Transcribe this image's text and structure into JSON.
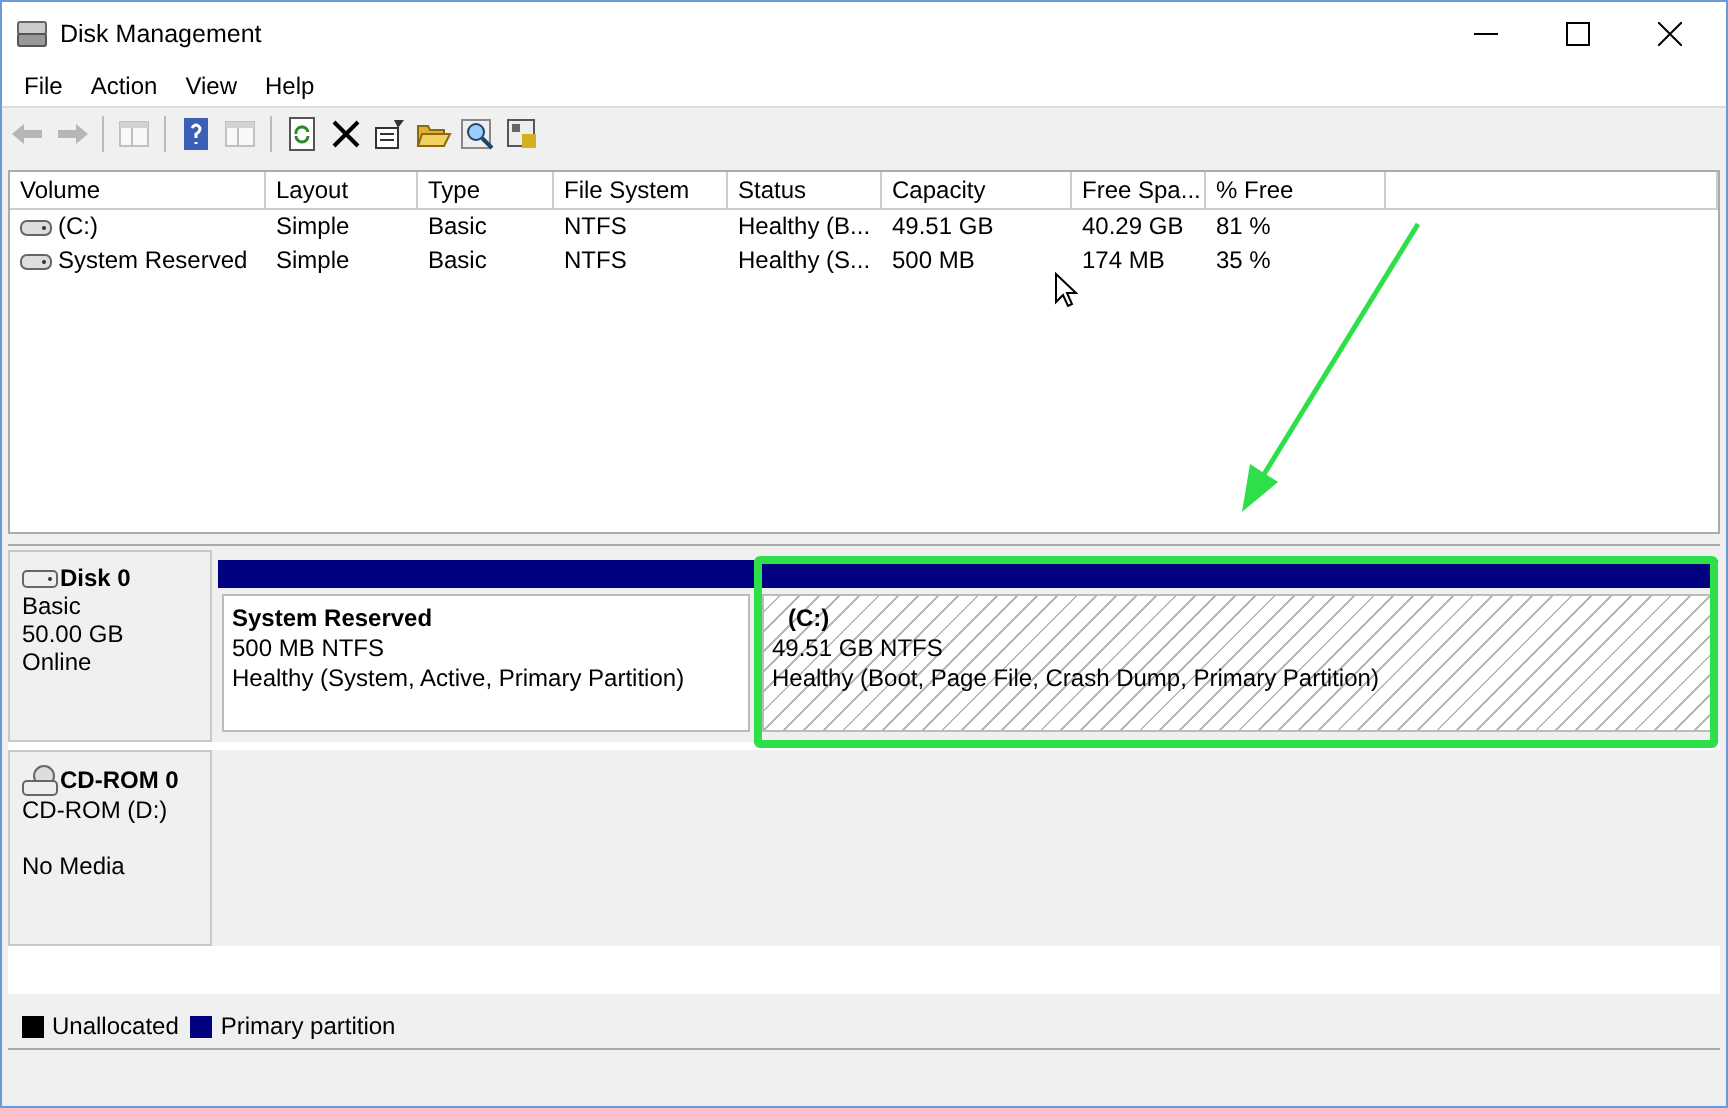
{
  "window": {
    "title": "Disk Management"
  },
  "menu": [
    "File",
    "Action",
    "View",
    "Help"
  ],
  "toolbar": [
    {
      "kind": "back",
      "disabled": true
    },
    {
      "kind": "forward",
      "disabled": true
    },
    {
      "kind": "sep"
    },
    {
      "kind": "tree",
      "disabled": true
    },
    {
      "kind": "sep"
    },
    {
      "kind": "help",
      "disabled": false
    },
    {
      "kind": "pane",
      "disabled": true
    },
    {
      "kind": "sep"
    },
    {
      "kind": "refresh",
      "disabled": false
    },
    {
      "kind": "delete",
      "disabled": false
    },
    {
      "kind": "properties",
      "disabled": false
    },
    {
      "kind": "open",
      "disabled": false
    },
    {
      "kind": "explore",
      "disabled": false
    },
    {
      "kind": "settings",
      "disabled": false
    }
  ],
  "table": {
    "columns": [
      "Volume",
      "Layout",
      "Type",
      "File System",
      "Status",
      "Capacity",
      "Free Spa...",
      "% Free"
    ],
    "rows": [
      [
        "(C:)",
        "Simple",
        "Basic",
        "NTFS",
        "Healthy (B...",
        "49.51 GB",
        "40.29 GB",
        "81 %"
      ],
      [
        "System Reserved",
        "Simple",
        "Basic",
        "NTFS",
        "Healthy (S...",
        "500 MB",
        "174 MB",
        "35 %"
      ]
    ]
  },
  "disks": [
    {
      "kind": "disk",
      "name": "Disk 0",
      "lines": [
        "Basic",
        "50.00 GB",
        "Online"
      ],
      "partitions": [
        {
          "name": "System Reserved",
          "size": "500 MB NTFS",
          "status": "Healthy (System, Active, Primary Partition)",
          "selected": false
        },
        {
          "name": "(C:)",
          "size": "49.51 GB NTFS",
          "status": "Healthy (Boot, Page File, Crash Dump, Primary Partition)",
          "selected": true
        }
      ]
    },
    {
      "kind": "cdrom",
      "name": "CD-ROM 0",
      "lines": [
        "CD-ROM (D:)",
        "No Media"
      ]
    }
  ],
  "legend": [
    {
      "label": "Unallocated",
      "color": "#000000"
    },
    {
      "label": "Primary partition",
      "color": "#000080"
    }
  ]
}
